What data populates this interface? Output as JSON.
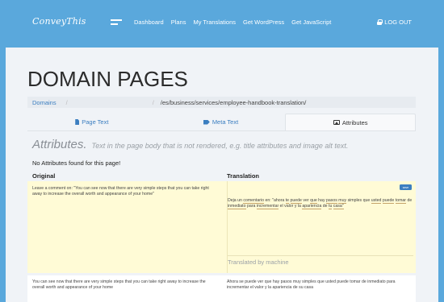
{
  "header": {
    "logo": "ConveyThis",
    "nav": [
      "Dashboard",
      "Plans",
      "My Translations",
      "Get WordPress",
      "Get JavaScript"
    ],
    "logout": "LOG OUT"
  },
  "page": {
    "title": "DOMAIN PAGES"
  },
  "breadcrumb": {
    "root": "Domains",
    "separator1": "/",
    "separator2": "/",
    "path": "/es/business/services/employee-handbook-translation/"
  },
  "tabs": [
    {
      "label": "Page Text",
      "active": false
    },
    {
      "label": "Meta Text",
      "active": false
    },
    {
      "label": "Attributes",
      "active": true
    }
  ],
  "attributes": {
    "heading": "Attributes.",
    "description": "Text in the page body that is not rendered, e.g. title attributes and image alt text.",
    "empty_message": "No Attributes found for this page!"
  },
  "table": {
    "original_header": "Original",
    "translation_header": "Translation",
    "rows": [
      {
        "original": "Leave a comment on: \"You can see now that there are very simple steps that you can take right away to increase the overall worth and appearance of your home\"",
        "badge": "save",
        "translation_words": [
          "Deja",
          "un",
          "comentario",
          "en:",
          "\"ahora",
          "te",
          "puede",
          "ver",
          "que",
          "hay",
          "pasos",
          "muy",
          "simples",
          "que",
          "usted",
          "puede",
          "tomar",
          "de",
          "inmediato",
          "para",
          "incrementar",
          "el",
          "valor",
          "y",
          "la",
          "apariencia",
          "de",
          "tu",
          "casa\""
        ],
        "machine_label": "Translated by machine"
      },
      {
        "original": "You can see now that there are very simple steps that you can take right away to increase the overall worth and appearance of your home",
        "translation": "Ahora se puede ver que hay pasos muy simples que usted puede tomar de inmediato para incrementar el valor y la apariencia de su casa"
      }
    ]
  },
  "colors": {
    "header_bg": "#5aa8dc",
    "panel_bg": "#f0f3f7",
    "link": "#3b7ec0",
    "highlight_row": "#fffbd6"
  }
}
